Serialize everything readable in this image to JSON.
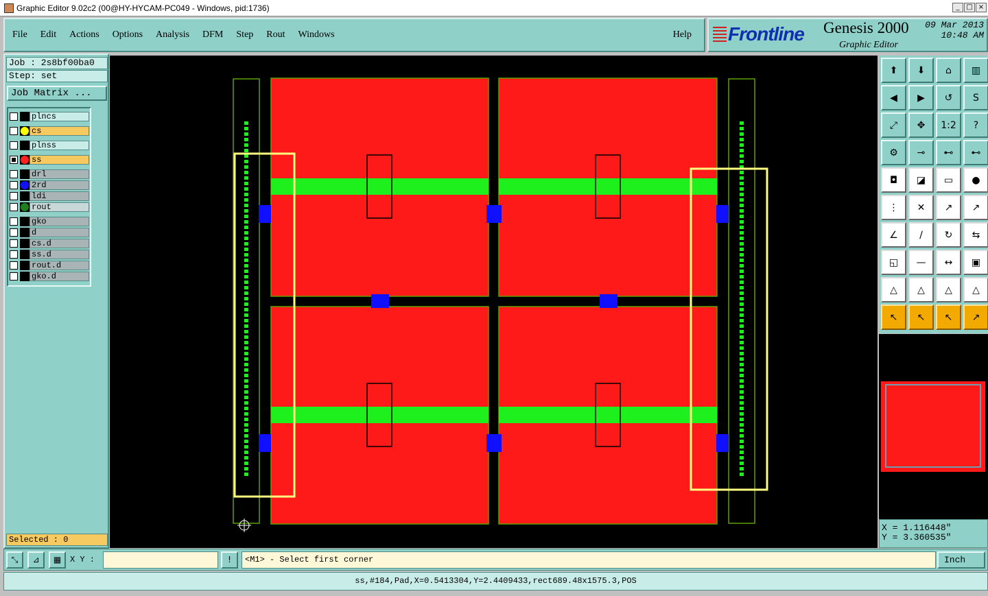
{
  "window": {
    "title": "Graphic Editor 9.02c2 (00@HY-HYCAM-PC049 - Windows, pid:1736)"
  },
  "menu": {
    "items": [
      "File",
      "Edit",
      "Actions",
      "Options",
      "Analysis",
      "DFM",
      "Step",
      "Rout",
      "Windows"
    ],
    "help": "Help"
  },
  "brand": {
    "logo": "Frontline",
    "product": "Genesis 2000",
    "subtitle": "Graphic Editor",
    "date": "09 Mar 2013",
    "time": "10:48 AM"
  },
  "job": {
    "job_label": "Job : 2s8bf00ba0",
    "step_label": "Step: set",
    "matrix_button": "Job Matrix ..."
  },
  "layers": [
    {
      "name": "plncs",
      "bg": "#c8ece8",
      "dot": ""
    },
    {
      "name": "cs",
      "bg": "#f7ca61",
      "dot": "#ffff00"
    },
    {
      "name": "plnss",
      "bg": "#c8ece8",
      "dot": ""
    },
    {
      "name": "ss",
      "bg": "#f7ca61",
      "dot": "#ff2020"
    },
    {
      "name": "drl",
      "bg": "#a8b4b6",
      "dot": ""
    },
    {
      "name": "2rd",
      "bg": "#a8b4b6",
      "dot": "#1010ff"
    },
    {
      "name": "ldi",
      "bg": "#a8b4b6",
      "dot": ""
    },
    {
      "name": "rout",
      "bg": "#c8d8d8",
      "dot": "#208020"
    },
    {
      "name": "gko",
      "bg": "#a8b4b6",
      "dot": ""
    },
    {
      "name": "d",
      "bg": "#a8b4b6",
      "dot": ""
    },
    {
      "name": "cs.d",
      "bg": "#a8b4b6",
      "dot": ""
    },
    {
      "name": "ss.d",
      "bg": "#a8b4b6",
      "dot": ""
    },
    {
      "name": "rout.d",
      "bg": "#a8b4b6",
      "dot": ""
    },
    {
      "name": "gko.d",
      "bg": "#a8b4b6",
      "dot": ""
    }
  ],
  "selected_label": "Selected : 0",
  "coords": {
    "x": "X = 1.116448\"",
    "y": "Y = 3.360535\""
  },
  "bottom": {
    "xy_label": "X Y :",
    "xy_value": "",
    "prompt": "<M1> - Select first corner",
    "unit": "Inch"
  },
  "status": "ss,#184,Pad,X=0.5413304,Y=2.4409433,rect689.48x1575.3,POS",
  "toolbox": {
    "icons": [
      "zoom-home-icon",
      "zoom-out-icon",
      "home-icon",
      "split-view-icon",
      "pan-left-icon",
      "pan-right-icon",
      "undo-icon",
      "snap-icon",
      "fit-icon",
      "zoom-fit-icon",
      "one-to-two-icon",
      "help-icon",
      "settings-icon",
      "measure-icon",
      "net-icon",
      "net-red-icon",
      "pad-icon",
      "feature-icon",
      "ruler-icon",
      "drill-icon",
      "connect-icon",
      "cross-icon",
      "move-icon",
      "copy-icon",
      "line-red-icon",
      "line-blue-icon",
      "arc-icon",
      "compare-icon",
      "node-icon",
      "line-icon",
      "bracket-icon",
      "grid-icon",
      "triangle-a-icon",
      "triangle-b-icon",
      "triangle-c-icon",
      "triangle-d-icon",
      "pointer-icon",
      "pointer-select-icon",
      "pointer-circle-icon",
      "pointer-route-icon"
    ]
  },
  "colors": {
    "panel": "#8fd0c9",
    "board": "#ff1a1a",
    "green": "#1ef01e",
    "accent": "#f7ca61"
  }
}
